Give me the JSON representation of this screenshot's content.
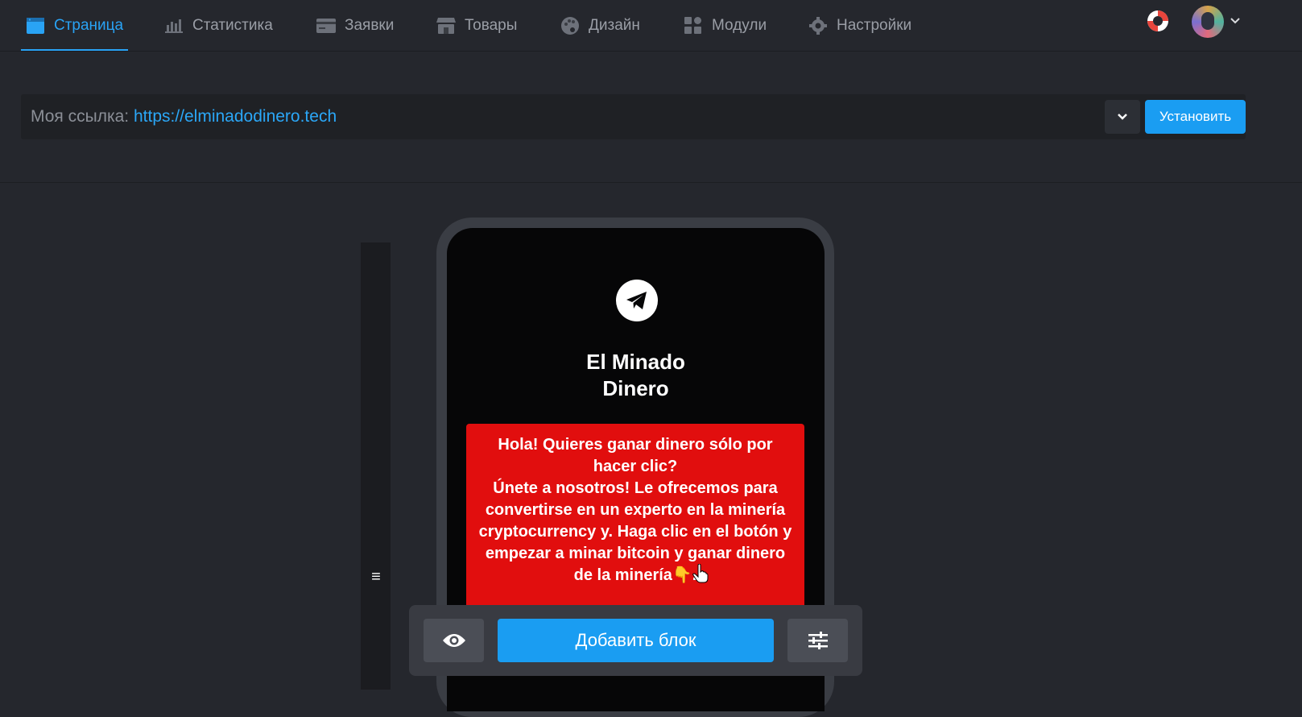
{
  "nav": {
    "items": [
      {
        "label": "Страница",
        "icon": "page-icon",
        "active": true
      },
      {
        "label": "Статистика",
        "icon": "stats-icon"
      },
      {
        "label": "Заявки",
        "icon": "card-icon"
      },
      {
        "label": "Товары",
        "icon": "store-icon"
      },
      {
        "label": "Дизайн",
        "icon": "palette-icon"
      },
      {
        "label": "Модули",
        "icon": "modules-icon"
      },
      {
        "label": "Настройки",
        "icon": "gear-icon"
      }
    ],
    "accent": "#29a3f5"
  },
  "link": {
    "label": "Моя ссылка: ",
    "url": "https://elminadodinero.tech",
    "install_label": "Установить"
  },
  "preview": {
    "title": "El Minado Dinero",
    "promo_text": "Hola! Quieres ganar dinero sólo por hacer clic?\nÚnete a nosotros! Le ofrecemos para convertirse en un experto en la minería cryptocurrency y. Haga clic en el botón y empezar a minar bitcoin y ganar dinero de la minería👇.",
    "promo_color": "#e10e0e"
  },
  "toolbar": {
    "add_block_label": "Добавить блок"
  }
}
